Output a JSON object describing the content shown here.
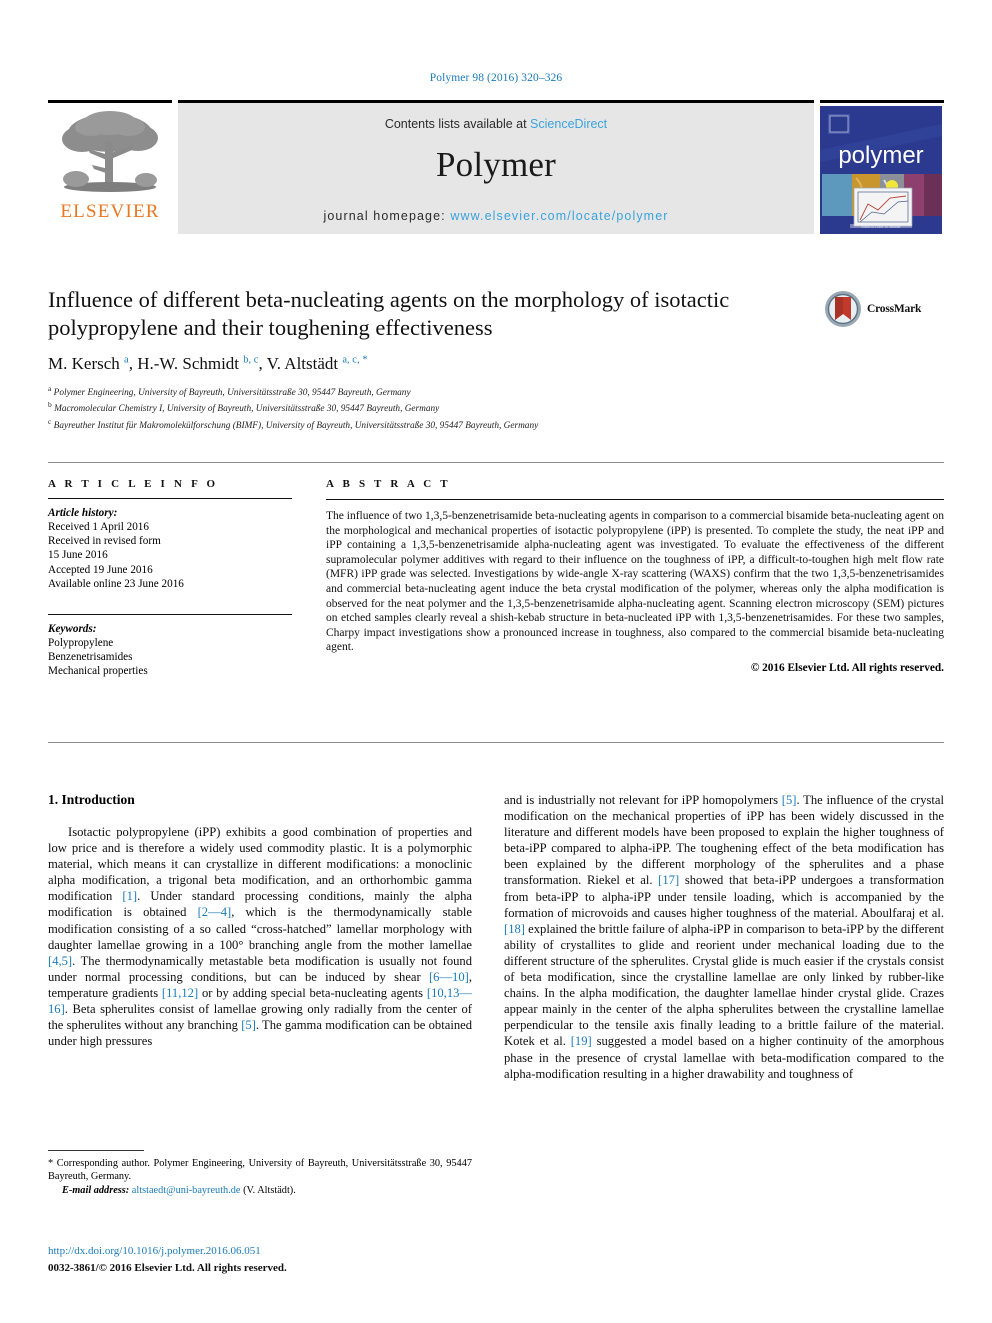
{
  "running_head": "Polymer 98 (2016) 320–326",
  "masthead": {
    "publisher_logo_label": "ELSEVIER",
    "contents_prefix": "Contents lists available at ",
    "contents_link": "ScienceDirect",
    "journal_name": "Polymer",
    "homepage_prefix": "journal homepage: ",
    "homepage_url": "www.elsevier.com/locate/polymer",
    "cover_title": "polymer"
  },
  "article": {
    "title": "Influence of different beta-nucleating agents on the morphology of isotactic polypropylene and their toughening effectiveness",
    "authors_html": "M. Kersch <sup>a</sup>, H.-W. Schmidt <sup>b, c</sup>, V. Altstädt <sup>a, c, *</sup>",
    "affiliations": [
      {
        "marker": "a",
        "text": "Polymer Engineering, University of Bayreuth, Universitätsstraße 30, 95447 Bayreuth, Germany"
      },
      {
        "marker": "b",
        "text": "Macromolecular Chemistry I, University of Bayreuth, Universitätsstraße 30, 95447 Bayreuth, Germany"
      },
      {
        "marker": "c",
        "text": "Bayreuther Institut für Makromolekülforschung (BIMF), University of Bayreuth, Universitätsstraße 30, 95447 Bayreuth, Germany"
      }
    ],
    "crossmark_label": "CrossMark"
  },
  "article_info": {
    "heading": "A R T I C L E   I N F O",
    "history_label": "Article history:",
    "history_lines": [
      "Received 1 April 2016",
      "Received in revised form",
      "15 June 2016",
      "Accepted 19 June 2016",
      "Available online 23 June 2016"
    ],
    "keywords_label": "Keywords:",
    "keywords": [
      "Polypropylene",
      "Benzenetrisamides",
      "Mechanical properties"
    ]
  },
  "abstract": {
    "heading": "A B S T R A C T",
    "text": "The influence of two 1,3,5-benzenetrisamide beta-nucleating agents in comparison to a commercial bisamide beta-nucleating agent on the morphological and mechanical properties of isotactic polypropylene (iPP) is presented. To complete the study, the neat iPP and iPP containing a 1,3,5-benzenetrisamide alpha-nucleating agent was investigated. To evaluate the effectiveness of the different supramolecular polymer additives with regard to their influence on the toughness of iPP, a difficult-to-toughen high melt flow rate (MFR) iPP grade was selected. Investigations by wide-angle X-ray scattering (WAXS) confirm that the two 1,3,5-benzenetrisamides and commercial beta-nucleating agent induce the beta crystal modification of the polymer, whereas only the alpha modification is observed for the neat polymer and the 1,3,5-benzenetrisamide alpha-nucleating agent. Scanning electron microscopy (SEM) pictures on etched samples clearly reveal a shish-kebab structure in beta-nucleated iPP with 1,3,5-benzenetrisamides. For these two samples, Charpy impact investigations show a pronounced increase in toughness, also compared to the commercial bisamide beta-nucleating agent.",
    "copyright": "© 2016 Elsevier Ltd. All rights reserved."
  },
  "body": {
    "section_number_title": "1. Introduction",
    "left_paragraph_html": "Isotactic polypropylene (iPP) exhibits a good combination of properties and low price and is therefore a widely used commodity plastic. It is a polymorphic material, which means it can crystallize in different modifications: a monoclinic alpha modification, a trigonal beta modification, and an orthorhombic gamma modification <span class=\"ref\">[1]</span>. Under standard processing conditions, mainly the alpha modification is obtained <span class=\"ref\">[2&#8212;4]</span>, which is the thermodynamically stable modification consisting of a so called &#8220;cross-hatched&#8221; lamellar morphology with daughter lamellae growing in a 100° branching angle from the mother lamellae <span class=\"ref\">[4,5]</span>. The thermodynamically metastable beta modification is usually not found under normal processing conditions, but can be induced by shear <span class=\"ref\">[6&#8212;10]</span>, temperature gradients <span class=\"ref\">[11,12]</span> or by adding special beta-nucleating agents <span class=\"ref\">[10,13&#8212;16]</span>. Beta spherulites consist of lamellae growing only radially from the center of the spherulites without any branching <span class=\"ref\">[5]</span>. The gamma modification can be obtained under high pressures",
    "right_paragraph_html": "and is industrially not relevant for iPP homopolymers <span class=\"ref\">[5]</span>. The influence of the crystal modification on the mechanical properties of iPP has been widely discussed in the literature and different models have been proposed to explain the higher toughness of beta-iPP compared to alpha-iPP. The toughening effect of the beta modification has been explained by the different morphology of the spherulites and a phase transformation. Riekel et al. <span class=\"ref\">[17]</span> showed that beta-iPP undergoes a transformation from beta-iPP to alpha-iPP under tensile loading, which is accompanied by the formation of microvoids and causes higher toughness of the material. Aboulfaraj et al. <span class=\"ref\">[18]</span> explained the brittle failure of alpha-iPP in comparison to beta-iPP by the different ability of crystallites to glide and reorient under mechanical loading due to the different structure of the spherulites. Crystal glide is much easier if the crystals consist of beta modification, since the crystalline lamellae are only linked by rubber-like chains. In the alpha modification, the daughter lamellae hinder crystal glide. Crazes appear mainly in the center of the alpha spherulites between the crystalline lamellae perpendicular to the tensile axis finally leading to a brittle failure of the material. Kotek et al. <span class=\"ref\">[19]</span> suggested a model based on a higher continuity of the amorphous phase in the presence of crystal lamellae with beta-modification compared to the alpha-modification resulting in a higher drawability and toughness of"
  },
  "footer": {
    "corresponding_marker": "*",
    "corresponding_text": "Corresponding author. Polymer Engineering, University of Bayreuth, Universitätsstraße 30, 95447 Bayreuth, Germany.",
    "email_label": "E-mail address:",
    "email": "altstaedt@uni-bayreuth.de",
    "email_owner": "(V. Altstädt).",
    "doi_url": "http://dx.doi.org/10.1016/j.polymer.2016.06.051",
    "issn_line": "0032-3861/© 2016 Elsevier Ltd. All rights reserved."
  },
  "colors": {
    "link_blue": "#1a7bb9",
    "elsevier_orange": "#E87722",
    "masthead_grey": "#e6e6e6",
    "cover_blue": "#2b3a8f"
  }
}
